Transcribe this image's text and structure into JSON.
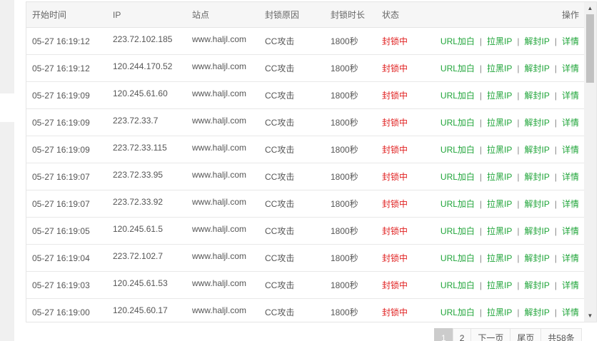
{
  "table": {
    "headers": {
      "start_time": "开始时间",
      "ip": "IP",
      "site": "站点",
      "reason": "封锁原因",
      "duration": "封锁时长",
      "status": "状态",
      "ops": "操作"
    },
    "actions": {
      "url_whitelist": "URL加白",
      "blacklist_ip": "拉黑IP",
      "unblock_ip": "解封IP",
      "details": "详情",
      "separator": "|"
    },
    "rows": [
      {
        "time": "05-27 16:19:12",
        "ip": "223.72.102.185",
        "site": "www.haljl.com",
        "reason": "CC攻击",
        "duration": "1800秒",
        "status": "封锁中"
      },
      {
        "time": "05-27 16:19:12",
        "ip": "120.244.170.52",
        "site": "www.haljl.com",
        "reason": "CC攻击",
        "duration": "1800秒",
        "status": "封锁中"
      },
      {
        "time": "05-27 16:19:09",
        "ip": "120.245.61.60",
        "site": "www.haljl.com",
        "reason": "CC攻击",
        "duration": "1800秒",
        "status": "封锁中"
      },
      {
        "time": "05-27 16:19:09",
        "ip": "223.72.33.7",
        "site": "www.haljl.com",
        "reason": "CC攻击",
        "duration": "1800秒",
        "status": "封锁中"
      },
      {
        "time": "05-27 16:19:09",
        "ip": "223.72.33.115",
        "site": "www.haljl.com",
        "reason": "CC攻击",
        "duration": "1800秒",
        "status": "封锁中"
      },
      {
        "time": "05-27 16:19:07",
        "ip": "223.72.33.95",
        "site": "www.haljl.com",
        "reason": "CC攻击",
        "duration": "1800秒",
        "status": "封锁中"
      },
      {
        "time": "05-27 16:19:07",
        "ip": "223.72.33.92",
        "site": "www.haljl.com",
        "reason": "CC攻击",
        "duration": "1800秒",
        "status": "封锁中"
      },
      {
        "time": "05-27 16:19:05",
        "ip": "120.245.61.5",
        "site": "www.haljl.com",
        "reason": "CC攻击",
        "duration": "1800秒",
        "status": "封锁中"
      },
      {
        "time": "05-27 16:19:04",
        "ip": "223.72.102.7",
        "site": "www.haljl.com",
        "reason": "CC攻击",
        "duration": "1800秒",
        "status": "封锁中"
      },
      {
        "time": "05-27 16:19:03",
        "ip": "120.245.61.53",
        "site": "www.haljl.com",
        "reason": "CC攻击",
        "duration": "1800秒",
        "status": "封锁中"
      },
      {
        "time": "05-27 16:19:00",
        "ip": "120.245.60.17",
        "site": "www.haljl.com",
        "reason": "CC攻击",
        "duration": "1800秒",
        "status": "封锁中"
      }
    ]
  },
  "scrollbar": {
    "up_icon": "▲",
    "down_icon": "▼"
  },
  "pagination": {
    "current": "1",
    "page2": "2",
    "next": "下一页",
    "last": "尾页",
    "total": "共58条"
  },
  "colors": {
    "action_green": "#20a53a",
    "status_red": "#e02020",
    "header_bg": "#f6f6f6",
    "active_page": "#cccccc"
  }
}
